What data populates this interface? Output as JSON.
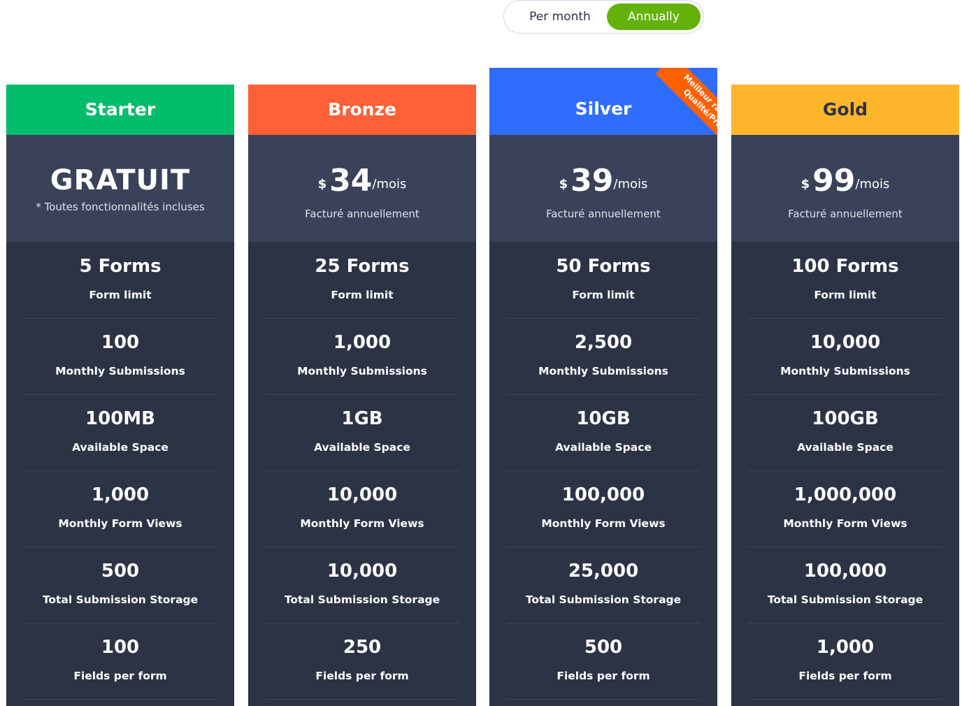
{
  "toggle": {
    "monthly": "Per month",
    "annual": "Annually"
  },
  "plans": [
    {
      "name": "Starter",
      "color": "#00bc6b",
      "name_color": "#ffffff",
      "price_main": "GRATUIT",
      "price_note": "* Toutes fonctionnalités incluses",
      "features": [
        {
          "value": "5 Forms",
          "label": "Form limit"
        },
        {
          "value": "100",
          "label": "Monthly Submissions"
        },
        {
          "value": "100MB",
          "label": "Available Space"
        },
        {
          "value": "1,000",
          "label": "Monthly Form Views"
        },
        {
          "value": "500",
          "label": "Total Submission Storage"
        },
        {
          "value": "100",
          "label": "Fields per form"
        }
      ]
    },
    {
      "name": "Bronze",
      "color": "#ff6038",
      "name_color": "#ffffff",
      "currency": "$",
      "amount": "34",
      "period": "/mois",
      "billing": "Facturé annuellement",
      "features": [
        {
          "value": "25 Forms",
          "label": "Form limit"
        },
        {
          "value": "1,000",
          "label": "Monthly Submissions"
        },
        {
          "value": "1GB",
          "label": "Available Space"
        },
        {
          "value": "10,000",
          "label": "Monthly Form Views"
        },
        {
          "value": "10,000",
          "label": "Total Submission Storage"
        },
        {
          "value": "250",
          "label": "Fields per form"
        }
      ]
    },
    {
      "name": "Silver",
      "color": "#2f6dff",
      "name_color": "#ffffff",
      "currency": "$",
      "amount": "39",
      "period": "/mois",
      "billing": "Facturé annuellement",
      "ribbon": "Meilleur rapport Qualité/Prix",
      "features": [
        {
          "value": "50 Forms",
          "label": "Form limit"
        },
        {
          "value": "2,500",
          "label": "Monthly Submissions"
        },
        {
          "value": "10GB",
          "label": "Available Space"
        },
        {
          "value": "100,000",
          "label": "Monthly Form Views"
        },
        {
          "value": "25,000",
          "label": "Total Submission Storage"
        },
        {
          "value": "500",
          "label": "Fields per form"
        }
      ]
    },
    {
      "name": "Gold",
      "color": "#ffb62c",
      "name_color": "#2c3345",
      "currency": "$",
      "amount": "99",
      "period": "/mois",
      "billing": "Facturé annuellement",
      "features": [
        {
          "value": "100 Forms",
          "label": "Form limit"
        },
        {
          "value": "10,000",
          "label": "Monthly Submissions"
        },
        {
          "value": "100GB",
          "label": "Available Space"
        },
        {
          "value": "1,000,000",
          "label": "Monthly Form Views"
        },
        {
          "value": "100,000",
          "label": "Total Submission Storage"
        },
        {
          "value": "1,000",
          "label": "Fields per form"
        }
      ]
    }
  ]
}
